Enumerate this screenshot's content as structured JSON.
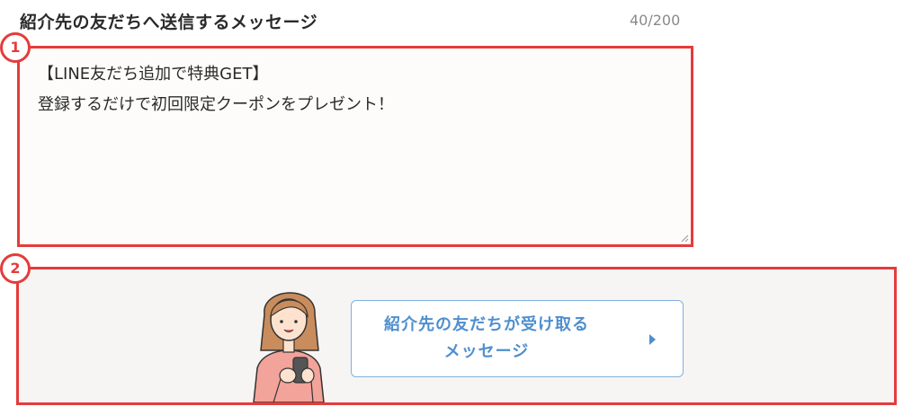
{
  "header": {
    "title": "紹介先の友だちへ送信するメッセージ",
    "char_count": "40/200"
  },
  "markers": {
    "first": "1",
    "second": "2"
  },
  "message": {
    "value": "【LINE友だち追加で特典GET】\n登録するだけで初回限定クーポンをプレゼント！"
  },
  "preview": {
    "button_label": "紹介先の友だちが受け取る\nメッセージ",
    "illustration": "woman-with-smartphone"
  },
  "colors": {
    "highlight": "#e63b3b",
    "accent": "#4f8fce"
  }
}
